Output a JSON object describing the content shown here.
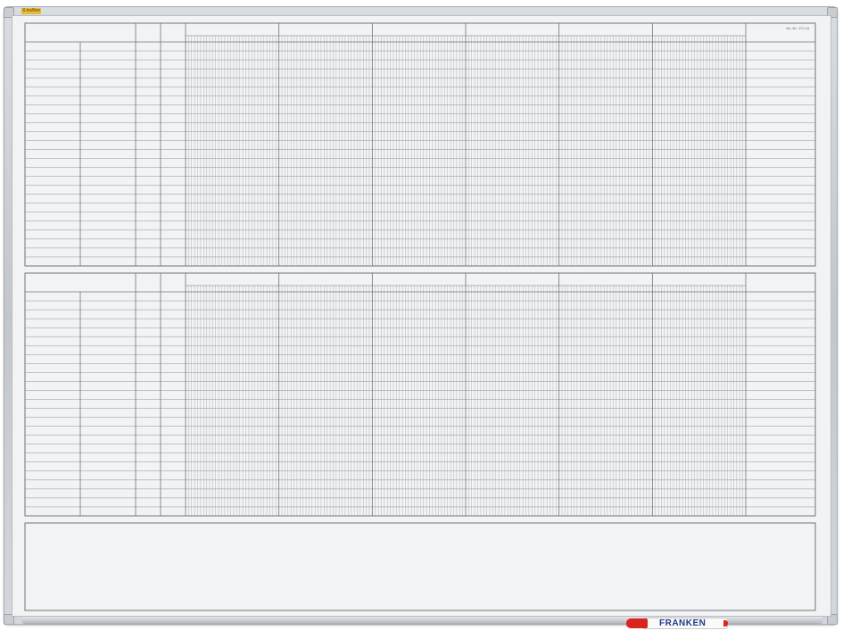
{
  "board": {
    "brand_logo": "X-tra!line",
    "reference_code": "Art.-Nr.: FO-24",
    "marker_brand": "FRANKEN",
    "colors": {
      "frame": "#c4c9ce",
      "surface": "#f2f3f4",
      "grid_line": "#6f7479",
      "marker_cap": "#d8261e",
      "marker_text": "#1f3a8a",
      "logo": "#e8b93a"
    }
  },
  "planner": {
    "sections": 2,
    "month_blocks_per_section": 6,
    "day_columns_per_block": 31,
    "rows_per_section": 25,
    "left_label_columns": 4,
    "notes_panel": true
  }
}
